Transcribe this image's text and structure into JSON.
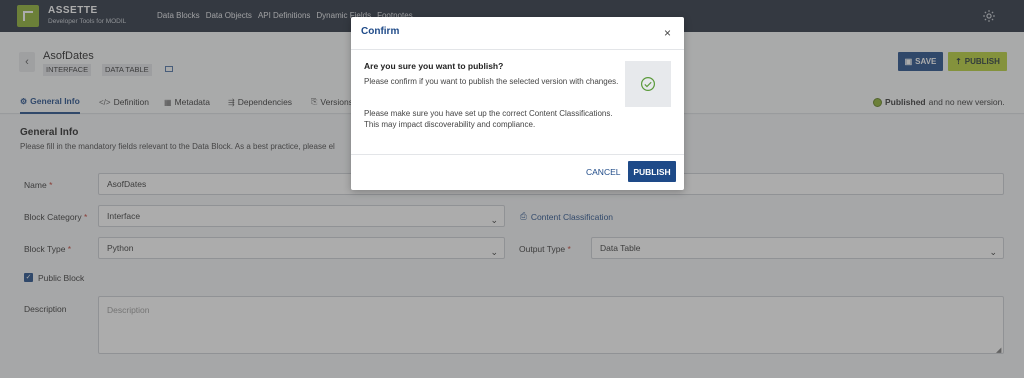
{
  "app": {
    "title": "ASSETTE",
    "subtitle": "Developer Tools for MODIL",
    "nav": [
      "Data Blocks",
      "Data Objects",
      "API Definitions",
      "Dynamic Fields",
      "Footnotes"
    ]
  },
  "header": {
    "page_title": "AsofDates",
    "tags": [
      "INTERFACE",
      "DATA TABLE"
    ],
    "save_label": "SAVE",
    "publish_label": "PUBLISH"
  },
  "tabs": [
    {
      "label": "General Info",
      "icon": "gear-icon",
      "active": true
    },
    {
      "label": "Definition",
      "icon": "code-icon"
    },
    {
      "label": "Metadata",
      "icon": "table-icon"
    },
    {
      "label": "Dependencies",
      "icon": "dependencies-icon"
    },
    {
      "label": "Versions",
      "icon": "versions-icon"
    }
  ],
  "status": {
    "bold": "Published",
    "rest": "and no new version."
  },
  "section": {
    "title": "General Info",
    "description": "Please fill in the mandatory fields relevant to the Data Block. As a best practice, please el"
  },
  "form": {
    "name_label": "Name",
    "name_value": "AsofDates",
    "category_label": "Block Category",
    "category_value": "Interface",
    "content_classification": "Content Classification",
    "type_label": "Block Type",
    "type_value": "Python",
    "output_label": "Output Type",
    "output_value": "Data Table",
    "public_label": "Public Block",
    "public_checked": true,
    "description_label": "Description",
    "description_placeholder": "Description",
    "required_mark": "*"
  },
  "modal": {
    "title": "Confirm",
    "close": "×",
    "question": "Are you sure you want to publish?",
    "line1": "Please confirm if you want to publish the selected version with changes.",
    "line2": "Please make sure you have set up the correct Content Classifications. This may impact discoverability and compliance.",
    "cancel_label": "CANCEL",
    "publish_label": "PUBLISH"
  },
  "colors": {
    "primary": "#1e4a88",
    "accent": "#b7cf33",
    "nav": "#252e3c"
  }
}
